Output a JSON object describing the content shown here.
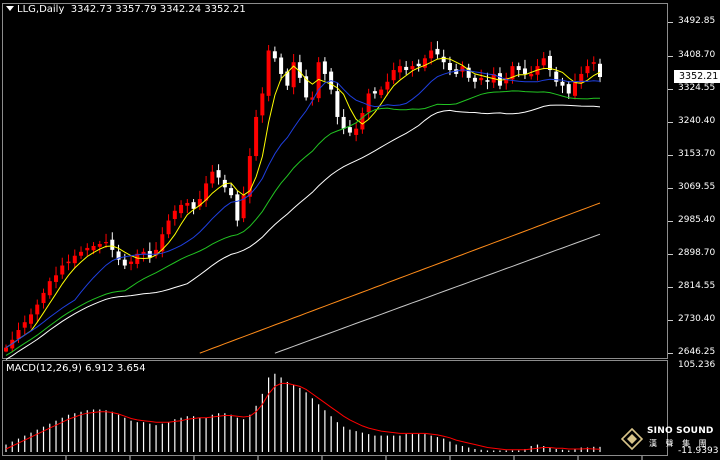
{
  "header": {
    "symbol": "LLG,Daily",
    "ohlc": "3342.73 3357.79 3342.24 3352.21"
  },
  "price_axis": {
    "labels": [
      "3492.85",
      "3408.70",
      "3324.55",
      "3240.40",
      "3153.70",
      "3069.55",
      "2985.40",
      "2898.70",
      "2814.55",
      "2730.40",
      "2646.25"
    ],
    "current_price": "3352.21"
  },
  "macd": {
    "label": "MACD(12,26,9) 6.912 3.654",
    "axis_max": "105.236",
    "axis_min": "-11.9393"
  },
  "watermark": {
    "brand_en": "SINO SOUND",
    "brand_cn": "漢 聲 集 團"
  },
  "colors": {
    "bull_candle": "#ff0000",
    "bear_candle": "#ffffff",
    "ma5": "#ffff00",
    "ma10": "#1f3fe0",
    "ma20": "#22c422",
    "ma30": "#ffffff",
    "ma60": "#ff8c1a",
    "ma120": "#c8c8c8",
    "macd_signal": "#ff0000",
    "macd_hist": "#ffffff"
  },
  "chart_data": {
    "type": "line",
    "description_series": [
      "close",
      "ma-yellow",
      "ma-blue",
      "ma-green",
      "ma-white",
      "ma-orange",
      "ma-gray"
    ],
    "ylim": [
      2646.25,
      3492.85
    ],
    "close": [
      2660,
      2680,
      2705,
      2725,
      2745,
      2770,
      2800,
      2830,
      2845,
      2870,
      2880,
      2895,
      2905,
      2915,
      2920,
      2925,
      2930,
      2910,
      2885,
      2870,
      2880,
      2900,
      2905,
      2890,
      2910,
      2950,
      2985,
      3010,
      3025,
      3030,
      3015,
      3040,
      3080,
      3110,
      3095,
      3070,
      3050,
      2985,
      3050,
      3150,
      3250,
      3310,
      3420,
      3400,
      3360,
      3330,
      3390,
      3350,
      3300,
      3300,
      3390,
      3360,
      3320,
      3250,
      3220,
      3210,
      3220,
      3260,
      3310,
      3310,
      3320,
      3340,
      3370,
      3380,
      3370,
      3380,
      3380,
      3400,
      3420,
      3410,
      3390,
      3370,
      3360,
      3380,
      3350,
      3340,
      3350,
      3340,
      3360,
      3330,
      3350,
      3380,
      3370,
      3360,
      3360,
      3380,
      3400,
      3370,
      3340,
      3330,
      3310,
      3340,
      3360,
      3380,
      3390,
      3352.21
    ],
    "ma_yellow_end": 3365,
    "ma_blue_end": 3345,
    "ma_green_end": 3340,
    "ma_white_end": 3300,
    "ma_orange_end": 3030,
    "ma_gray_end": 2950,
    "macd_hist": [
      10,
      14,
      18,
      22,
      26,
      30,
      34,
      38,
      42,
      46,
      50,
      52,
      54,
      56,
      57,
      57,
      56,
      54,
      50,
      46,
      42,
      40,
      40,
      38,
      36,
      38,
      40,
      44,
      46,
      48,
      48,
      46,
      46,
      50,
      52,
      52,
      50,
      46,
      44,
      50,
      62,
      78,
      100,
      105,
      100,
      94,
      90,
      86,
      80,
      72,
      64,
      56,
      48,
      40,
      34,
      30,
      28,
      26,
      24,
      22,
      22,
      22,
      22,
      22,
      24,
      24,
      24,
      24,
      22,
      20,
      18,
      14,
      10,
      8,
      6,
      4,
      3,
      2,
      2,
      2,
      2,
      2,
      2,
      4,
      8,
      10,
      8,
      6,
      4,
      3,
      2,
      4,
      6,
      6,
      7,
      6.9
    ],
    "macd_signal": [
      4,
      8,
      12,
      16,
      20,
      24,
      28,
      32,
      36,
      40,
      44,
      47,
      50,
      52,
      53,
      54,
      54,
      53,
      51,
      48,
      45,
      43,
      42,
      41,
      40,
      40,
      40,
      41,
      42,
      44,
      45,
      46,
      46,
      47,
      48,
      49,
      49,
      48,
      47,
      48,
      54,
      64,
      78,
      88,
      92,
      92,
      90,
      88,
      84,
      78,
      72,
      66,
      60,
      54,
      48,
      43,
      39,
      35,
      32,
      30,
      28,
      27,
      26,
      25,
      25,
      25,
      25,
      25,
      24,
      23,
      21,
      19,
      16,
      14,
      12,
      10,
      8,
      6,
      5,
      4,
      3,
      3,
      3,
      3,
      4,
      5,
      6,
      6,
      5,
      5,
      4,
      4,
      4,
      4.5,
      4,
      3.6
    ]
  }
}
